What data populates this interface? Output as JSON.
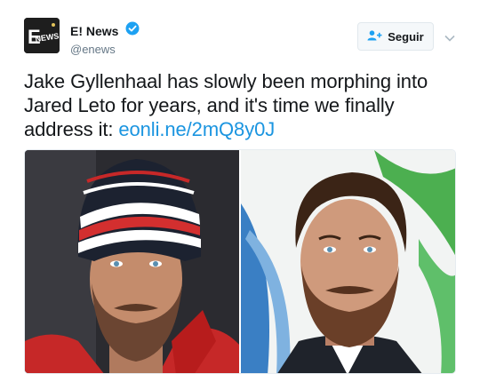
{
  "account": {
    "display_name": "E! News",
    "handle": "@enews",
    "verified": true,
    "avatar_logo_text": "ENEWS"
  },
  "follow_button": {
    "label": "Seguir",
    "icon": "add-user-icon"
  },
  "menu": {
    "icon": "chevron-down-icon"
  },
  "tweet": {
    "text": "Jake Gyllenhaal has slowly been morphing into Jared Leto for years, and it's time we finally address it: ",
    "link_text": "eonli.ne/2mQ8y0J"
  },
  "colors": {
    "accent": "#1b95e0",
    "verified_badge": "#1da1f2",
    "avatar_bg": "#222222",
    "avatar_accent": "#e2c35a",
    "text": "#14171a",
    "secondary_text": "#657786"
  }
}
